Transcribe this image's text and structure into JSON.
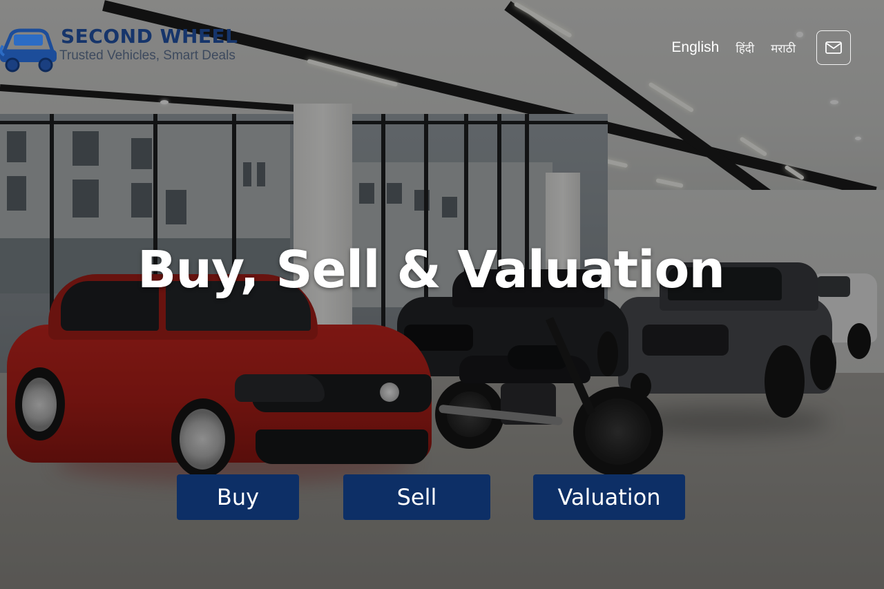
{
  "brand": {
    "name": "SECOND WHEEL",
    "tagline": "Trusted Vehicles, Smart Deals",
    "logo_icon": "car-icon"
  },
  "header": {
    "languages": [
      {
        "label": "English"
      },
      {
        "label": "हिंदी"
      },
      {
        "label": "मराठी"
      }
    ],
    "mail_icon": "mail-icon"
  },
  "hero": {
    "headline": "Buy, Sell & Valuation",
    "background": "car-showroom-photo",
    "buttons": {
      "buy": "Buy",
      "sell": "Sell",
      "valuation": "Valuation"
    }
  },
  "colors": {
    "brand_navy": "#16356b",
    "button_bg": "#0d2f66",
    "button_text": "#ffffff"
  }
}
